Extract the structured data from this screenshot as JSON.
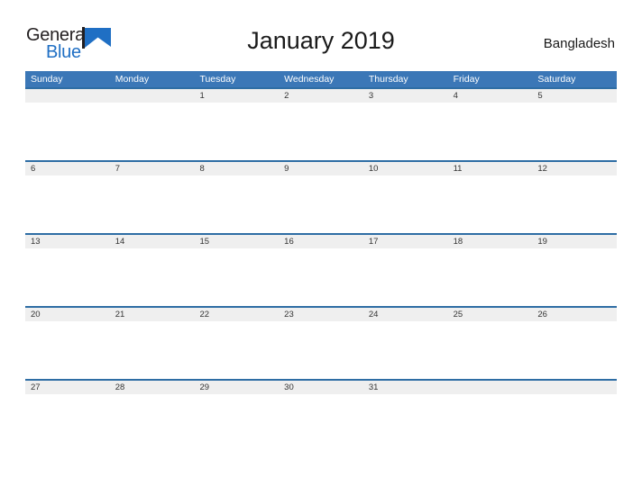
{
  "brand": {
    "name_part1": "General",
    "name_part2": "Blue",
    "mark": "triangle-flag-icon",
    "color_dark": "#231f20",
    "color_blue": "#1f6fc4"
  },
  "header": {
    "title": "January 2019",
    "region": "Bangladesh"
  },
  "theme": {
    "header_bar": "#3b77b7",
    "row_rule": "#2e6da4",
    "date_band": "#efefef",
    "page_background": "#ffffff",
    "date_text": "#333333",
    "weekday_text": "#ffffff"
  },
  "calendar": {
    "month": "January",
    "year": "2019",
    "weekday_headers": [
      "Sunday",
      "Monday",
      "Tuesday",
      "Wednesday",
      "Thursday",
      "Friday",
      "Saturday"
    ],
    "weeks": [
      [
        "",
        "",
        "1",
        "2",
        "3",
        "4",
        "5"
      ],
      [
        "6",
        "7",
        "8",
        "9",
        "10",
        "11",
        "12"
      ],
      [
        "13",
        "14",
        "15",
        "16",
        "17",
        "18",
        "19"
      ],
      [
        "20",
        "21",
        "22",
        "23",
        "24",
        "25",
        "26"
      ],
      [
        "27",
        "28",
        "29",
        "30",
        "31",
        "",
        ""
      ]
    ]
  }
}
